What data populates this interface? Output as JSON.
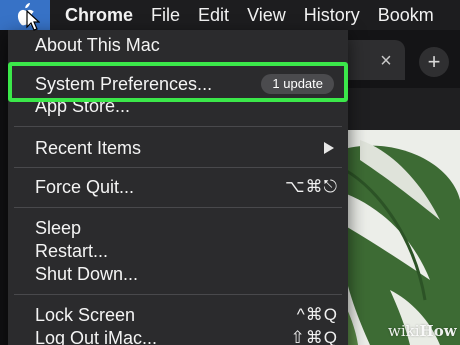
{
  "menubar": {
    "apple_icon": "apple-logo",
    "app_name": "Chrome",
    "menus": [
      "File",
      "Edit",
      "View",
      "History",
      "Bookm"
    ]
  },
  "browser": {
    "tab_close_glyph": "×",
    "new_tab_glyph": "+"
  },
  "apple_menu": {
    "about": "About This Mac",
    "system_preferences": "System Preferences...",
    "system_preferences_badge": "1 update",
    "app_store": "App Store...",
    "recent_items": "Recent Items",
    "force_quit": "Force Quit...",
    "force_quit_shortcut": "⌥⌘⎋",
    "sleep": "Sleep",
    "restart": "Restart...",
    "shut_down": "Shut Down...",
    "lock_screen": "Lock Screen",
    "lock_screen_shortcut": "^⌘Q",
    "log_out": "Log Out iMac...",
    "log_out_shortcut": "⇧⌘Q"
  },
  "colors": {
    "highlight": "#3be84a",
    "apple_button": "#3772c6",
    "menu_background": "#2b2b2d"
  },
  "watermark": {
    "prefix": "wiki",
    "suffix": "How"
  }
}
